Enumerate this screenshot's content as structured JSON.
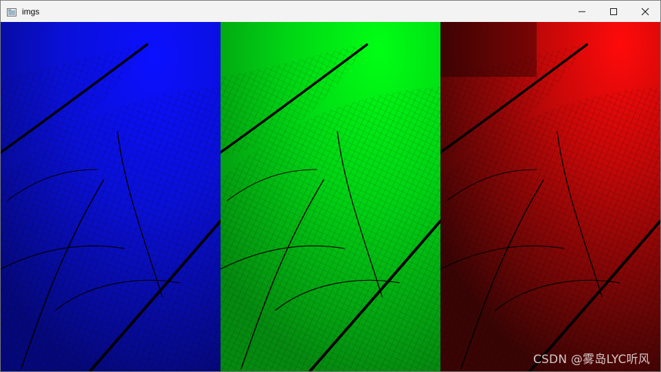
{
  "window": {
    "title": "imgs",
    "app_icon": "window-app-icon",
    "controls": {
      "minimize": "minimize-icon",
      "maximize": "maximize-icon",
      "close": "close-icon"
    }
  },
  "image": {
    "panels": [
      {
        "channel": "blue",
        "color": "#0000ff"
      },
      {
        "channel": "green",
        "color": "#00ff00"
      },
      {
        "channel": "red",
        "color": "#ff0000"
      }
    ],
    "watermark": "CSDN @雾岛LYC听风"
  }
}
